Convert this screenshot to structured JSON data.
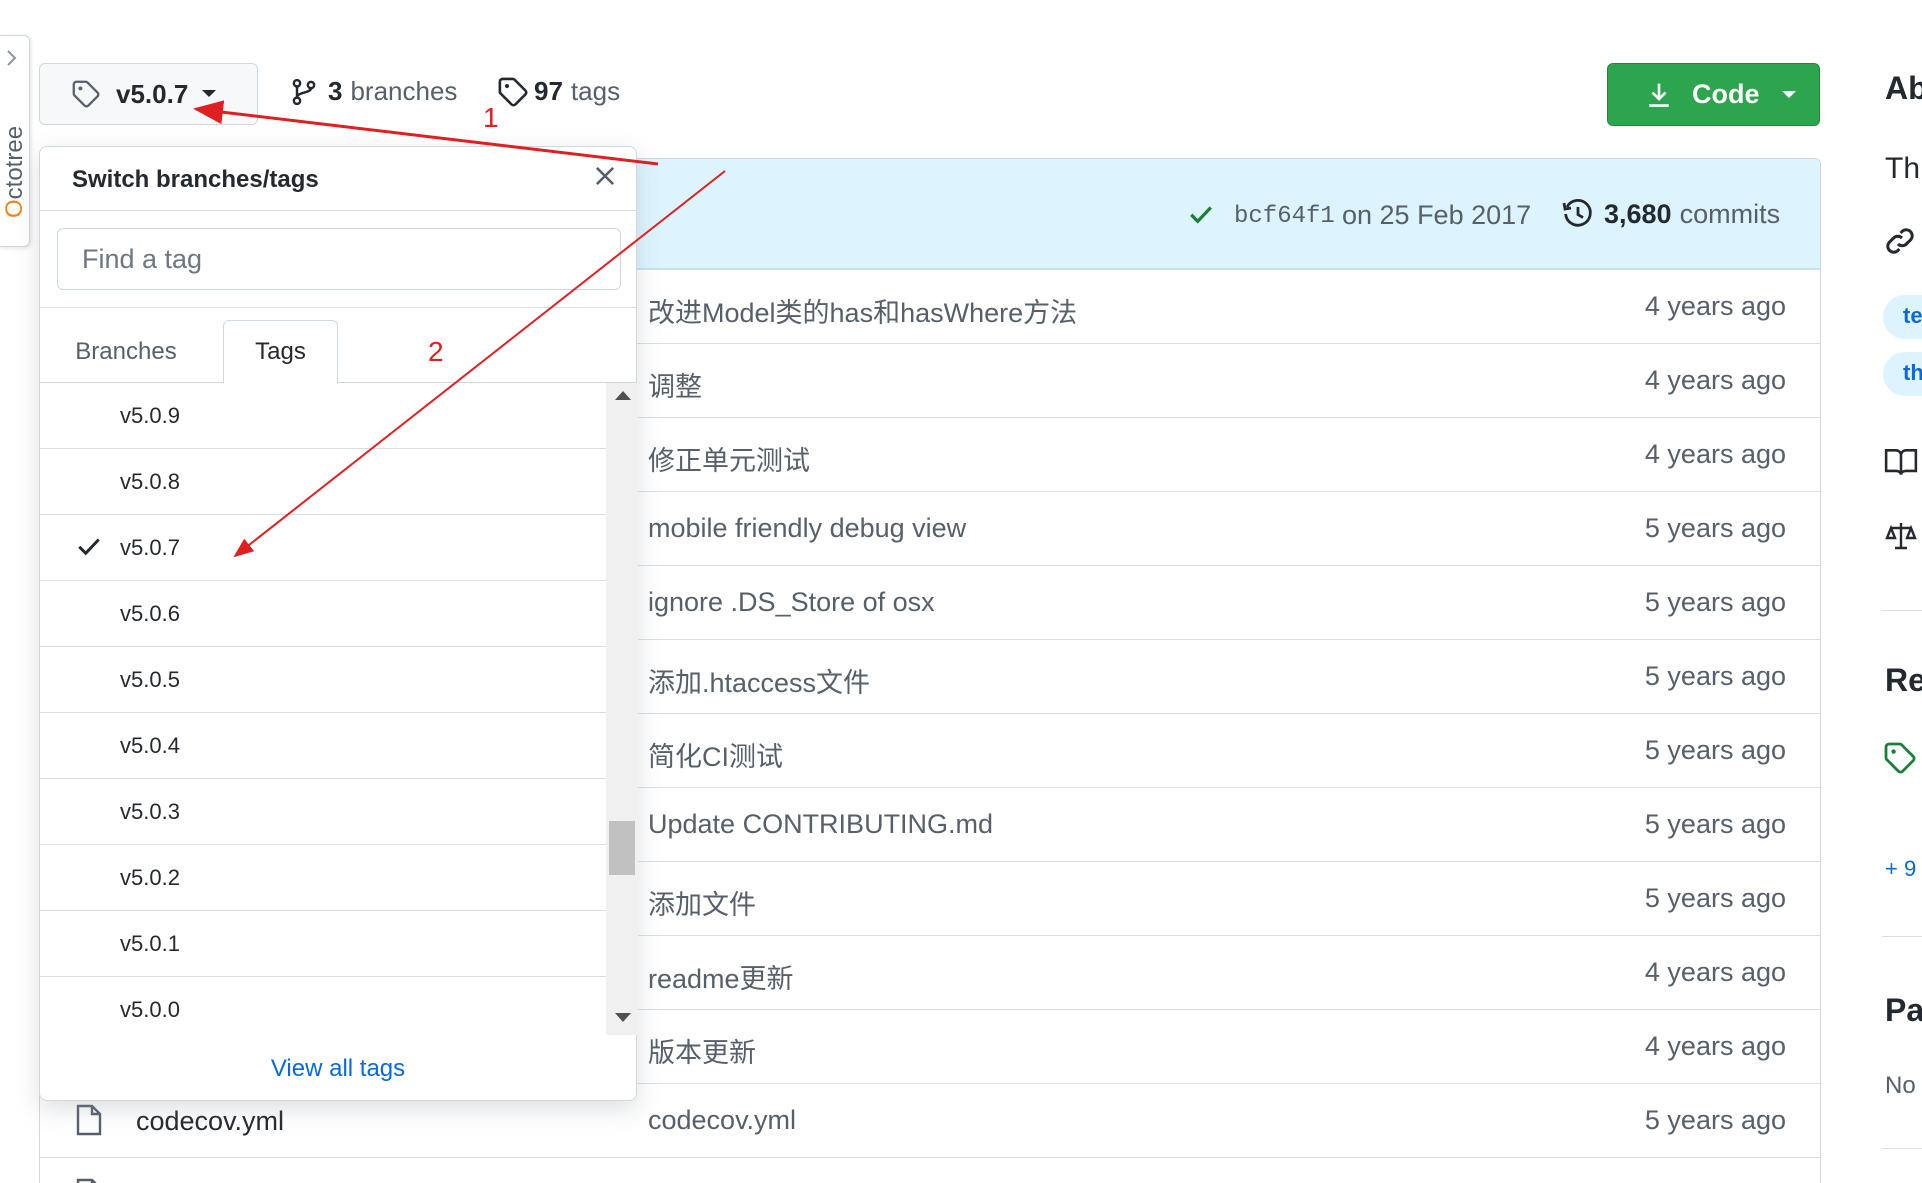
{
  "octotree": {
    "label": "Octotree"
  },
  "ref_selector": {
    "current": "v5.0.7"
  },
  "branches": {
    "count": "3",
    "label": "branches"
  },
  "tags": {
    "count": "97",
    "label": "tags"
  },
  "code_button": {
    "label": "Code"
  },
  "latest_commit": {
    "sha": "bcf64f1",
    "date": "on 25 Feb 2017",
    "commits_count": "3,680",
    "commits_label": "commits"
  },
  "files": [
    {
      "message": "改进Model类的has和hasWhere方法",
      "age": "4 years ago"
    },
    {
      "message": "调整",
      "age": "4 years ago"
    },
    {
      "message": "修正单元测试",
      "age": "4 years ago"
    },
    {
      "message": "mobile friendly debug view",
      "age": "5 years ago"
    },
    {
      "message": "ignore .DS_Store of osx",
      "age": "5 years ago"
    },
    {
      "message": "添加.htaccess文件",
      "age": "5 years ago"
    },
    {
      "message": "简化CI测试",
      "age": "5 years ago"
    },
    {
      "message": "Update CONTRIBUTING.md",
      "age": "5 years ago"
    },
    {
      "message": "添加文件",
      "age": "5 years ago"
    },
    {
      "message": "readme更新",
      "age": "4 years ago"
    },
    {
      "message": "版本更新",
      "age": "4 years ago"
    },
    {
      "name": "codecov.yml",
      "message": "codecov.yml",
      "age": "5 years ago"
    },
    {
      "message": "...",
      "age": ""
    }
  ],
  "dropdown": {
    "title": "Switch branches/tags",
    "search_placeholder": "Find a tag",
    "tab_branches": "Branches",
    "tab_tags": "Tags",
    "items": [
      "v5.0.9",
      "v5.0.8",
      "v5.0.7",
      "v5.0.6",
      "v5.0.5",
      "v5.0.4",
      "v5.0.3",
      "v5.0.2",
      "v5.0.1",
      "v5.0.0"
    ],
    "selected": "v5.0.7",
    "view_all": "View all tags"
  },
  "sidebar": {
    "about_heading": "Ab",
    "desc_fragment": "Th",
    "topic_1": "te",
    "topic_2": "th",
    "releases_heading": "Re",
    "more_link": "+ 9",
    "packages_heading": "Pa",
    "packages_text": "No"
  },
  "annotations": {
    "one": "1",
    "two": "2",
    "color": "#e02020"
  },
  "colors": {
    "primary_button": "#2da44e",
    "link": "#0969da",
    "commit_bar": "#ddf4ff"
  }
}
